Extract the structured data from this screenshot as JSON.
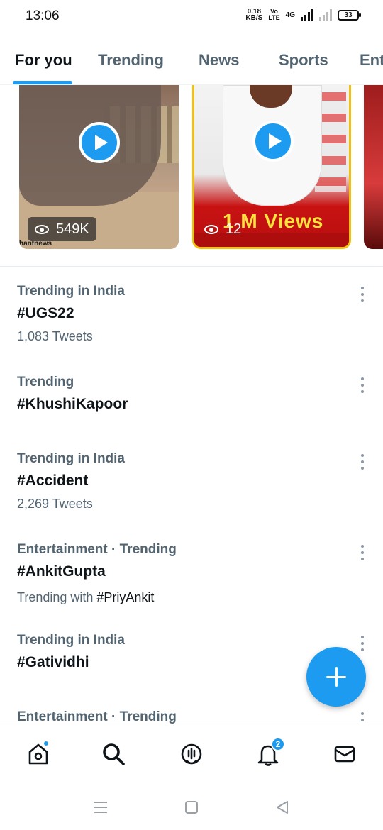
{
  "status_bar": {
    "time": "13:06",
    "speed_value": "0.18",
    "speed_unit": "KB/S",
    "volte_top": "Vo",
    "volte_bottom": "LTE",
    "network": "4G",
    "battery": "33"
  },
  "tabs": [
    {
      "label": "For you",
      "active": true
    },
    {
      "label": "Trending",
      "active": false
    },
    {
      "label": "News",
      "active": false
    },
    {
      "label": "Sports",
      "active": false
    },
    {
      "label": "Ent",
      "active": false
    }
  ],
  "videos": [
    {
      "views": "549K",
      "watermark": "hantnews"
    },
    {
      "views": "12",
      "overlay_text": "1 M Views"
    }
  ],
  "trends": [
    {
      "meta": "Trending in India",
      "title": "#UGS22",
      "sub": "1,083 Tweets"
    },
    {
      "meta": "Trending",
      "title": "#KhushiKapoor",
      "sub": ""
    },
    {
      "meta": "Trending in India",
      "title": "#Accident",
      "sub": "2,269 Tweets"
    },
    {
      "meta": "Entertainment · Trending",
      "title": "#AnkitGupta",
      "sub_prefix": "Trending with ",
      "sub_link": "#PriyAnkit"
    },
    {
      "meta": "Trending in India",
      "title": "#Gatividhi",
      "sub": ""
    },
    {
      "meta": "Entertainment · Trending",
      "title": "",
      "sub": ""
    }
  ],
  "bottom_nav": {
    "notifications_count": "2"
  },
  "colors": {
    "accent": "#1d9bf0",
    "secondary_text": "#536471",
    "primary_text": "#0f1419"
  }
}
